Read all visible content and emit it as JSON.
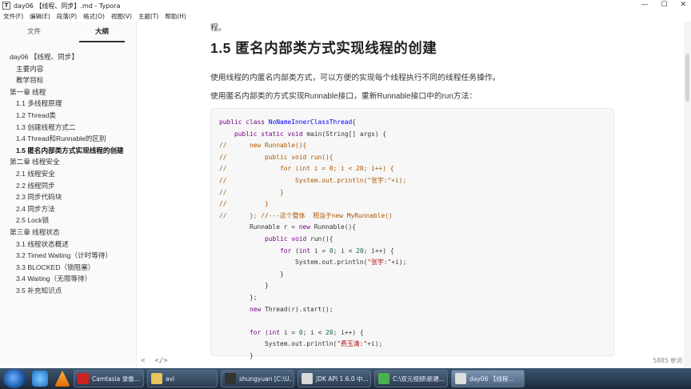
{
  "window": {
    "title": "day06 【线程、同步】.md - Typora",
    "minimize": "—",
    "maximize": "☐",
    "close": "✕"
  },
  "menu": [
    "文件(F)",
    "编辑(E)",
    "段落(P)",
    "格式(O)",
    "视图(V)",
    "主题(T)",
    "帮助(H)"
  ],
  "sidebar": {
    "tabs": [
      {
        "label": "文件",
        "active": false
      },
      {
        "label": "大纲",
        "active": true
      }
    ],
    "outline": [
      {
        "label": "day06 【线程、同步】",
        "level": 1
      },
      {
        "label": "主要内容",
        "level": 2
      },
      {
        "label": "教学目标",
        "level": 2
      },
      {
        "label": "第一章 线程",
        "level": 1
      },
      {
        "label": "1.1 多线程原理",
        "level": 2
      },
      {
        "label": "1.2 Thread类",
        "level": 2
      },
      {
        "label": "1.3 创建线程方式二",
        "level": 2
      },
      {
        "label": "1.4 Thread和Runnable的区别",
        "level": 2
      },
      {
        "label": "1.5 匿名内部类方式实现线程的创建",
        "level": 2,
        "active": true
      },
      {
        "label": "第二章 线程安全",
        "level": 1
      },
      {
        "label": "2.1 线程安全",
        "level": 2
      },
      {
        "label": "2.2 线程同步",
        "level": 2
      },
      {
        "label": "2.3 同步代码块",
        "level": 2
      },
      {
        "label": "2.4 同步方法",
        "level": 2
      },
      {
        "label": "2.5 Lock锁",
        "level": 2
      },
      {
        "label": "第三章 线程状态",
        "level": 1
      },
      {
        "label": "3.1 线程状态概述",
        "level": 2
      },
      {
        "label": "3.2 Timed Waiting（计时等待）",
        "level": 2
      },
      {
        "label": "3.3 BLOCKED（锁阻塞）",
        "level": 2
      },
      {
        "label": "3.4 Waiting（无限等待）",
        "level": 2
      },
      {
        "label": "3.5 补充知识点",
        "level": 2
      }
    ]
  },
  "main": {
    "prev_text": "程。",
    "heading": "1.5 匿名内部类方式实现线程的创建",
    "para1": "使用线程的内匿名内部类方式，可以方便的实现每个线程执行不同的线程任务操作。",
    "para2": "使用匿名内部类的方式实现Runnable接口，重新Runnable接口中的run方法：",
    "code": [
      [
        [
          "kw",
          "public "
        ],
        [
          "kw",
          "class "
        ],
        [
          "def",
          "NoNameInnerClassThread"
        ],
        [
          "",
          "{"
        ]
      ],
      [
        [
          "",
          "    "
        ],
        [
          "kw",
          "public "
        ],
        [
          "kw",
          "static "
        ],
        [
          "kw",
          "void "
        ],
        [
          "",
          "main(String[] args) {"
        ]
      ],
      [
        [
          "cm",
          "//      new Runnable(){"
        ]
      ],
      [
        [
          "cm",
          "//          public void run(){"
        ]
      ],
      [
        [
          "cm",
          "//              for (int i = 0; i < 20; i++) {"
        ]
      ],
      [
        [
          "cm",
          "//                  System.out.println(\"张宇:\"+i);"
        ]
      ],
      [
        [
          "cm",
          "//              }"
        ]
      ],
      [
        [
          "cm",
          "//          }"
        ]
      ],
      [
        [
          "cm",
          "//      }; //---这个整体  相当于new MyRunnable()"
        ]
      ],
      [
        [
          "",
          "        Runnable r = "
        ],
        [
          "kw",
          "new "
        ],
        [
          "",
          "Runnable(){"
        ]
      ],
      [
        [
          "",
          "            "
        ],
        [
          "kw",
          "public "
        ],
        [
          "kw",
          "void "
        ],
        [
          "",
          "run(){"
        ]
      ],
      [
        [
          "",
          "                "
        ],
        [
          "kw",
          "for "
        ],
        [
          "",
          "("
        ],
        [
          "kw",
          "int "
        ],
        [
          "",
          "i = "
        ],
        [
          "num",
          "0"
        ],
        [
          "",
          "; i < "
        ],
        [
          "num",
          "20"
        ],
        [
          "",
          "; i++) {"
        ]
      ],
      [
        [
          "",
          "                    System.out.println("
        ],
        [
          "str",
          "\"张宇:\""
        ],
        [
          "",
          "+i);"
        ]
      ],
      [
        [
          "",
          "                }"
        ]
      ],
      [
        [
          "",
          "            }"
        ]
      ],
      [
        [
          "",
          "        };"
        ]
      ],
      [
        [
          "",
          "        "
        ],
        [
          "kw",
          "new "
        ],
        [
          "",
          "Thread(r).start();"
        ]
      ],
      [
        [
          "",
          ""
        ]
      ],
      [
        [
          "",
          "        "
        ],
        [
          "kw",
          "for "
        ],
        [
          "",
          "("
        ],
        [
          "kw",
          "int "
        ],
        [
          "",
          "i = "
        ],
        [
          "num",
          "0"
        ],
        [
          "",
          "; i < "
        ],
        [
          "num",
          "20"
        ],
        [
          "",
          "; i++) {"
        ]
      ],
      [
        [
          "",
          "            System.out.println("
        ],
        [
          "str",
          "\"费玉清:\""
        ],
        [
          "",
          "+i);"
        ]
      ],
      [
        [
          "",
          "        }"
        ]
      ]
    ]
  },
  "statusbar": {
    "back": "<",
    "source_mode": "</>",
    "word_count": "5885 单词"
  },
  "taskbar": {
    "items": [
      {
        "label": "Camtasia 录像...",
        "color": "#cc2222",
        "active": false
      },
      {
        "label": "avi",
        "color": "#e8c35a",
        "active": false
      },
      {
        "label": "shungyuan [C:\\U...",
        "color": "#333333",
        "active": false
      },
      {
        "label": "JDK API 1.6.0 中...",
        "color": "#d9d9d9",
        "active": false
      },
      {
        "label": "C:\\双元视频\\新建...",
        "color": "#4caf50",
        "active": false
      },
      {
        "label": "day06 【线程...",
        "color": "#dddddd",
        "active": true
      }
    ]
  }
}
